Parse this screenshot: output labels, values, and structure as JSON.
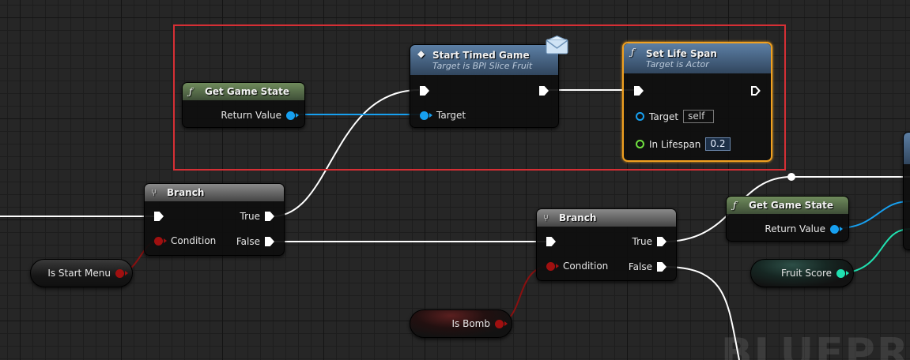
{
  "watermark": "BLUEPRINT",
  "nodes": {
    "get_game_state_1": {
      "icon": "function-icon",
      "title": "Get Game State",
      "return_label": "Return Value"
    },
    "start_timed_game": {
      "icon": "interface-message-icon",
      "title": "Start Timed Game",
      "subtitle": "Target is BPI Slice Fruit",
      "target_label": "Target"
    },
    "set_life_span": {
      "icon": "function-icon",
      "title": "Set Life Span",
      "subtitle": "Target is Actor",
      "target_label": "Target",
      "target_value": "self",
      "lifespan_label": "In Lifespan",
      "lifespan_value": "0.2"
    },
    "branch_1": {
      "icon": "branch-icon",
      "title": "Branch",
      "condition_label": "Condition",
      "true_label": "True",
      "false_label": "False"
    },
    "branch_2": {
      "icon": "branch-icon",
      "title": "Branch",
      "condition_label": "Condition",
      "true_label": "True",
      "false_label": "False"
    },
    "get_game_state_2": {
      "icon": "function-icon",
      "title": "Get Game State",
      "return_label": "Return Value"
    }
  },
  "variables": {
    "is_start_menu": "Is Start Menu",
    "is_bomb": "Is Bomb",
    "fruit_score": "Fruit Score"
  },
  "colors": {
    "comment_border": "#d62f35",
    "selected_outline": "#f0a020",
    "object_pin": "#17a0f0",
    "bool_pin": "#a01010",
    "int_pin": "#20e0b0",
    "float_pin": "#70e040",
    "exec_wire": "#ffffff"
  }
}
